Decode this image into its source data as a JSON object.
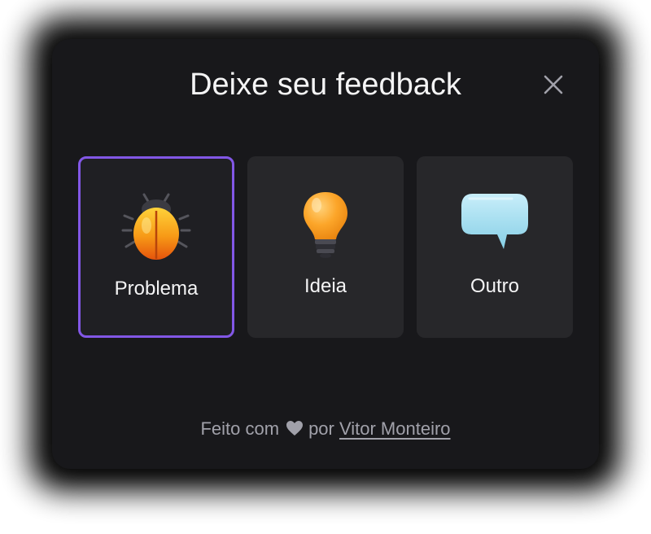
{
  "widget": {
    "title": "Deixe seu feedback",
    "close_icon": "close-icon",
    "accent_color": "#8257e6",
    "options": [
      {
        "label": "Problema",
        "icon": "bug-icon",
        "selected": true
      },
      {
        "label": "Ideia",
        "icon": "lightbulb-icon",
        "selected": false
      },
      {
        "label": "Outro",
        "icon": "speech-bubble-icon",
        "selected": false
      }
    ],
    "footer": {
      "prefix": "Feito com",
      "heart_icon": "heart-icon",
      "middle": "por",
      "author_link": "Vitor Monteiro"
    }
  }
}
